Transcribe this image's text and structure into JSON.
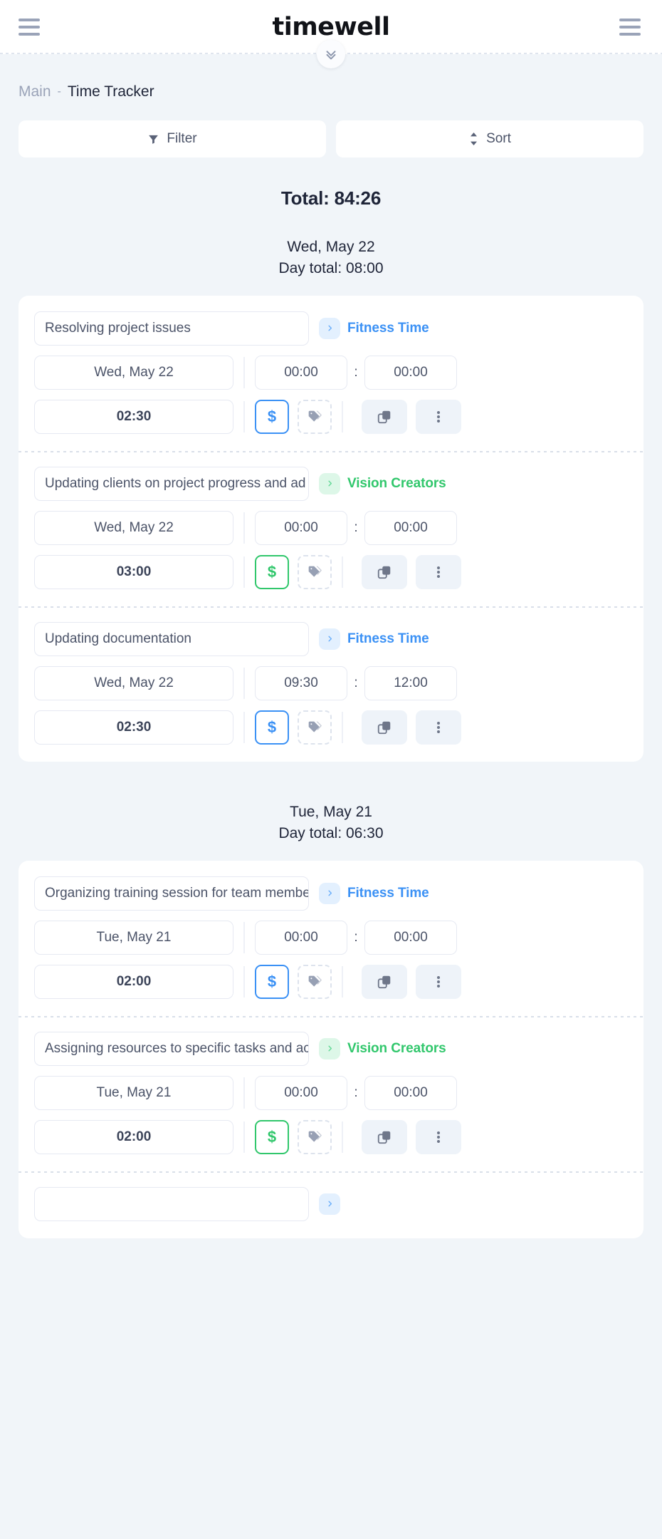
{
  "header": {
    "brand": "timewell",
    "left_menu_icon": "hamburger-icon",
    "right_menu_icon": "hamburger-icon",
    "collapse_icon": "chevron-double-down-icon"
  },
  "breadcrumb": {
    "root": "Main",
    "separator": "-",
    "current": "Time Tracker"
  },
  "toolbar": {
    "filter_label": "Filter",
    "sort_label": "Sort"
  },
  "summary": {
    "total_label": "Total: 84:26"
  },
  "colors": {
    "accent_blue": "#3b91f5",
    "accent_green": "#31c76c",
    "page_bg": "#f1f5f9",
    "card_bg": "#ffffff",
    "text_dark": "#1e2438",
    "text_muted": "#9aa3b8"
  },
  "days": [
    {
      "date_label": "Wed, May 22",
      "day_total_label": "Day total: 08:00",
      "entries": [
        {
          "description": "Resolving project issues",
          "project": "Fitness Time",
          "project_color": "blue",
          "date": "Wed, May 22",
          "start": "00:00",
          "separator": ":",
          "end": "00:00",
          "duration": "02:30",
          "billable_symbol": "$",
          "billable_color": "blue",
          "tag_icon": "tag-icon",
          "copy_icon": "copy-icon",
          "menu_icon": "kebab-menu-icon"
        },
        {
          "description": "Updating clients on project progress and ad",
          "project": "Vision Creators",
          "project_color": "green",
          "date": "Wed, May 22",
          "start": "00:00",
          "separator": ":",
          "end": "00:00",
          "duration": "03:00",
          "billable_symbol": "$",
          "billable_color": "green",
          "tag_icon": "tag-icon",
          "copy_icon": "copy-icon",
          "menu_icon": "kebab-menu-icon"
        },
        {
          "description": "Updating documentation",
          "project": "Fitness Time",
          "project_color": "blue",
          "date": "Wed, May 22",
          "start": "09:30",
          "separator": ":",
          "end": "12:00",
          "duration": "02:30",
          "billable_symbol": "$",
          "billable_color": "blue",
          "tag_icon": "tag-icon",
          "copy_icon": "copy-icon",
          "menu_icon": "kebab-menu-icon"
        }
      ]
    },
    {
      "date_label": "Tue, May 21",
      "day_total_label": "Day total: 06:30",
      "entries": [
        {
          "description": "Organizing training session for team members",
          "project": "Fitness Time",
          "project_color": "blue",
          "date": "Tue, May 21",
          "start": "00:00",
          "separator": ":",
          "end": "00:00",
          "duration": "02:00",
          "billable_symbol": "$",
          "billable_color": "blue",
          "tag_icon": "tag-icon",
          "copy_icon": "copy-icon",
          "menu_icon": "kebab-menu-icon"
        },
        {
          "description": "Assigning resources to specific tasks and ac",
          "project": "Vision Creators",
          "project_color": "green",
          "date": "Tue, May 21",
          "start": "00:00",
          "separator": ":",
          "end": "00:00",
          "duration": "02:00",
          "billable_symbol": "$",
          "billable_color": "green",
          "tag_icon": "tag-icon",
          "copy_icon": "copy-icon",
          "menu_icon": "kebab-menu-icon"
        },
        {
          "description": "",
          "project": "",
          "project_color": "blue",
          "date": "",
          "start": "",
          "separator": ":",
          "end": "",
          "duration": "",
          "billable_symbol": "$",
          "billable_color": "blue",
          "tag_icon": "tag-icon",
          "copy_icon": "copy-icon",
          "menu_icon": "kebab-menu-icon"
        }
      ]
    }
  ]
}
